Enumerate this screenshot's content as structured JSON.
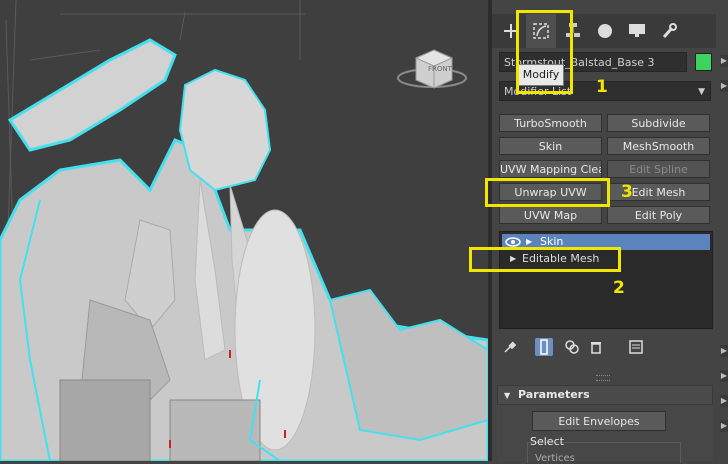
{
  "viewport": {
    "view_cube_label": "FRONT"
  },
  "command_panel": {
    "tabs": [
      {
        "name": "create",
        "icon": "plus-icon"
      },
      {
        "name": "modify",
        "icon": "modify-bend-icon",
        "active": true
      },
      {
        "name": "hierarchy",
        "icon": "hierarchy-icon"
      },
      {
        "name": "motion",
        "icon": "motion-circle-icon"
      },
      {
        "name": "display",
        "icon": "monitor-icon"
      },
      {
        "name": "utilities",
        "icon": "wrench-icon"
      }
    ],
    "object_name": "Stormstout_Balstad_Base 3",
    "object_color": "#3dd35e",
    "tooltip": "Modify",
    "modifier_list": "Modifier List",
    "modifier_buttons": [
      {
        "label": "TurboSmooth",
        "enabled": true
      },
      {
        "label": "Subdivide",
        "enabled": true
      },
      {
        "label": "Skin",
        "enabled": true
      },
      {
        "label": "MeshSmooth",
        "enabled": true
      },
      {
        "label": "UVW Mapping Clear",
        "enabled": true
      },
      {
        "label": "Edit Spline",
        "enabled": false
      },
      {
        "label": "Unwrap UVW",
        "enabled": true
      },
      {
        "label": "Edit Mesh",
        "enabled": true
      },
      {
        "label": "UVW Map",
        "enabled": true
      },
      {
        "label": "Edit Poly",
        "enabled": true
      }
    ],
    "stack": [
      {
        "label": "Skin",
        "selected": true
      },
      {
        "label": "Editable Mesh",
        "selected": false
      }
    ],
    "parameters": {
      "title": "Parameters",
      "edit_envelopes": "Edit Envelopes",
      "select_label": "Select",
      "vertices_label": "Vertices"
    }
  },
  "annotations": {
    "step1": "1",
    "step2": "2",
    "step3": "3",
    "highlight_color": "#f1e600"
  }
}
